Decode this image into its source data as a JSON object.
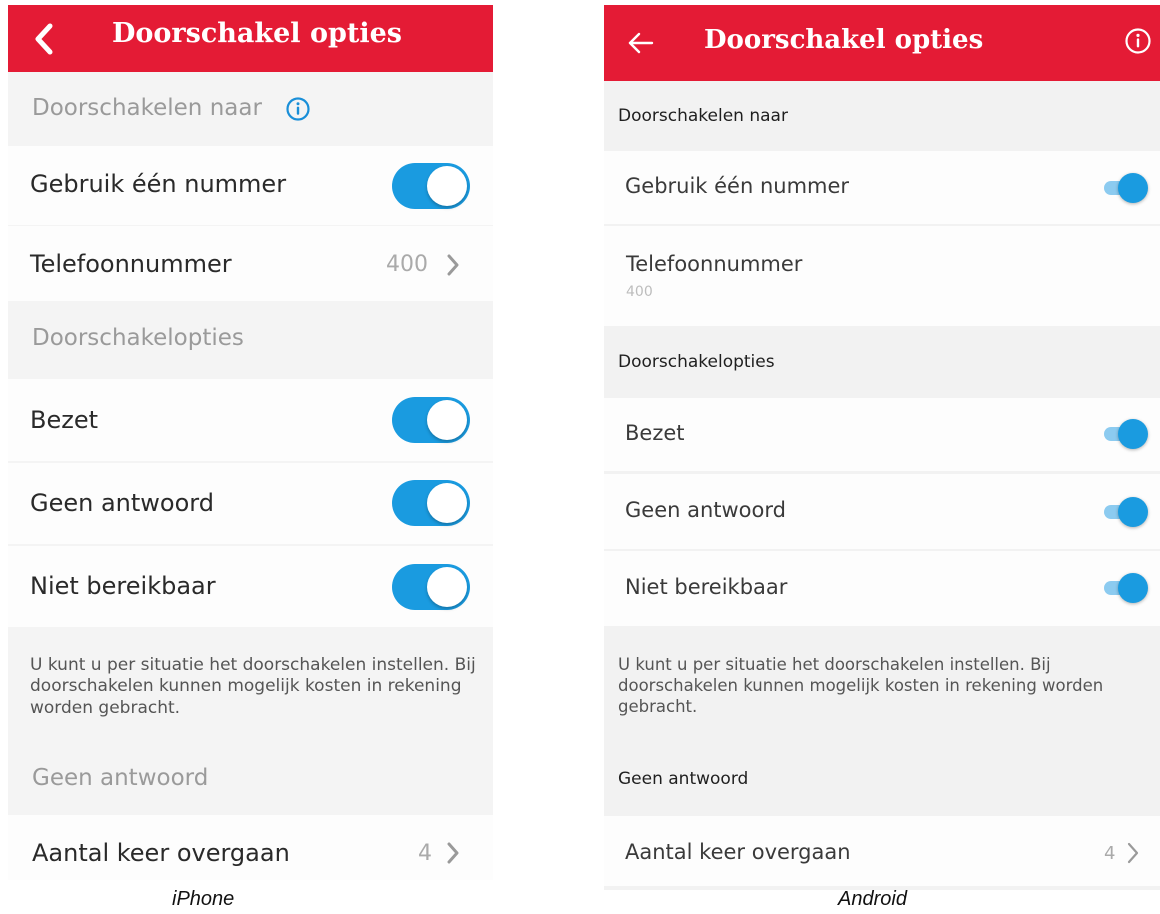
{
  "ios": {
    "header": {
      "title": "Doorschakel opties"
    },
    "forward_to": {
      "label": "Doorschakelen naar",
      "info_icon": "info-circle-icon"
    },
    "use_one_number": {
      "label": "Gebruik één nummer",
      "on": true
    },
    "phone_number": {
      "label": "Telefoonnummer",
      "value": "400"
    },
    "options_section": {
      "label": "Doorschakelopties"
    },
    "busy": {
      "label": "Bezet",
      "on": true
    },
    "no_answer": {
      "label": "Geen antwoord",
      "on": true
    },
    "unreachable": {
      "label": "Niet bereikbaar",
      "on": true
    },
    "note": "U kunt u per situatie het doorschakelen instellen. Bij doorschakelen kunnen mogelijk kosten in rekening worden gebracht.",
    "no_answer_section": {
      "label": "Geen antwoord"
    },
    "ring_count": {
      "label": "Aantal keer overgaan",
      "value": "4"
    }
  },
  "android": {
    "header": {
      "title": "Doorschakel opties",
      "info_icon": "info-circle-icon"
    },
    "forward_to": {
      "label": "Doorschakelen naar"
    },
    "use_one_number": {
      "label": "Gebruik één nummer",
      "on": true
    },
    "phone_number": {
      "label": "Telefoonnummer",
      "value": "400"
    },
    "options_section": {
      "label": "Doorschakelopties"
    },
    "busy": {
      "label": "Bezet",
      "on": true
    },
    "no_answer": {
      "label": "Geen antwoord",
      "on": true
    },
    "unreachable": {
      "label": "Niet bereikbaar",
      "on": true
    },
    "note": "U kunt u per situatie het doorschakelen instellen. Bij doorschakelen kunnen mogelijk kosten in rekening worden gebracht.",
    "no_answer_section": {
      "label": "Geen antwoord"
    },
    "ring_count": {
      "label": "Aantal keer overgaan",
      "value": "4"
    }
  },
  "captions": {
    "ios": "iPhone",
    "android": "Android"
  },
  "colors": {
    "header_red": "#e41b35",
    "toggle_blue": "#1a9be0",
    "switch_track": "#8ccbf0",
    "info_blue": "#1a8fd8"
  }
}
